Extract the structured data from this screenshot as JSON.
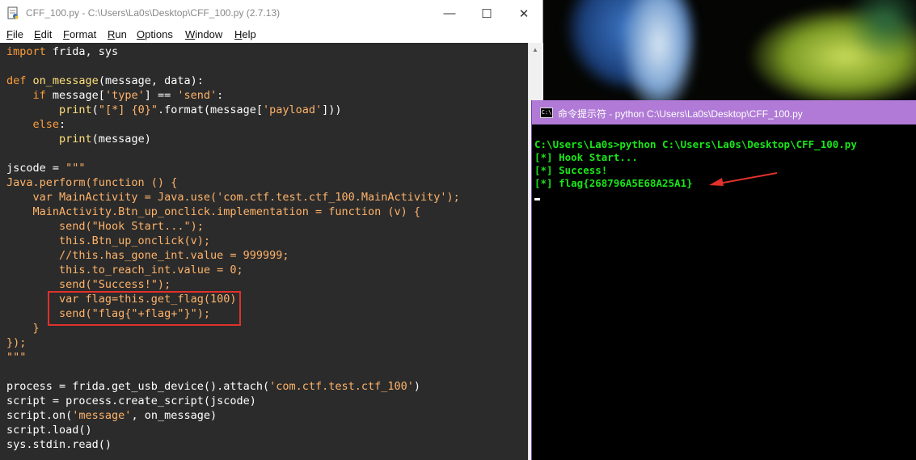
{
  "idle": {
    "title": "CFF_100.py - C:\\Users\\La0s\\Desktop\\CFF_100.py (2.7.13)",
    "controls": {
      "minimize": "—",
      "maximize": "☐",
      "close": "✕"
    },
    "menu": [
      {
        "key": "F",
        "rest": "ile"
      },
      {
        "key": "E",
        "rest": "dit"
      },
      {
        "key": "F",
        "rest": "ormat"
      },
      {
        "key": "R",
        "rest": "un"
      },
      {
        "key": "O",
        "rest": "ptions"
      },
      {
        "key": "W",
        "rest": "indow"
      },
      {
        "key": "H",
        "rest": "elp"
      }
    ],
    "code": [
      [
        [
          "kw",
          "import"
        ],
        [
          "t",
          " frida, sys"
        ]
      ],
      [],
      [
        [
          "kw",
          "def"
        ],
        [
          "t",
          " "
        ],
        [
          "fn",
          "on_message"
        ],
        [
          "t",
          "(message, data):"
        ]
      ],
      [
        [
          "t",
          "    "
        ],
        [
          "kw",
          "if"
        ],
        [
          "t",
          " message["
        ],
        [
          "str",
          "'type'"
        ],
        [
          "t",
          "] == "
        ],
        [
          "str",
          "'send'"
        ],
        [
          "t",
          ":"
        ]
      ],
      [
        [
          "t",
          "        "
        ],
        [
          "bi",
          "print"
        ],
        [
          "t",
          "("
        ],
        [
          "str",
          "\"[*] {0}\""
        ],
        [
          "t",
          ".format(message["
        ],
        [
          "str",
          "'payload'"
        ],
        [
          "t",
          "]))"
        ]
      ],
      [
        [
          "t",
          "    "
        ],
        [
          "kw",
          "else"
        ],
        [
          "t",
          ":"
        ]
      ],
      [
        [
          "t",
          "        "
        ],
        [
          "bi",
          "print"
        ],
        [
          "t",
          "(message)"
        ]
      ],
      [],
      [
        [
          "t",
          "jscode = "
        ],
        [
          "str",
          "\"\"\""
        ]
      ],
      [
        [
          "js",
          "Java.perform(function () {"
        ]
      ],
      [
        [
          "js",
          "    var MainActivity = Java.use('com.ctf.test.ctf_100.MainActivity');"
        ]
      ],
      [
        [
          "js",
          "    MainActivity.Btn_up_onclick.implementation = function (v) {"
        ]
      ],
      [
        [
          "js",
          "        send(\"Hook Start...\");"
        ]
      ],
      [
        [
          "js",
          "        this.Btn_up_onclick(v);"
        ]
      ],
      [
        [
          "js",
          "        //this.has_gone_int.value = 999999;"
        ]
      ],
      [
        [
          "js",
          "        this.to_reach_int.value = 0;"
        ]
      ],
      [
        [
          "js",
          "        send(\"Success!\");"
        ]
      ],
      [
        [
          "js",
          "        var flag=this.get_flag(100)"
        ]
      ],
      [
        [
          "js",
          "        send(\"flag{\"+flag+\"}\");"
        ]
      ],
      [
        [
          "js",
          "    }"
        ]
      ],
      [
        [
          "js",
          "});"
        ]
      ],
      [
        [
          "js",
          "\"\"\""
        ]
      ],
      [],
      [
        [
          "t",
          "process = frida.get_usb_device().attach("
        ],
        [
          "str",
          "'com.ctf.test.ctf_100'"
        ],
        [
          "t",
          ")"
        ]
      ],
      [
        [
          "t",
          "script = process.create_script(jscode)"
        ]
      ],
      [
        [
          "t",
          "script.on("
        ],
        [
          "str",
          "'message'"
        ],
        [
          "t",
          ", on_message)"
        ]
      ],
      [
        [
          "t",
          "script.load()"
        ]
      ],
      [
        [
          "t",
          "sys.stdin.read()"
        ]
      ]
    ]
  },
  "cmd": {
    "title": "命令提示符 - python  C:\\Users\\La0s\\Desktop\\CFF_100.py",
    "icon_label": "C:\\",
    "lines": [
      "C:\\Users\\La0s>python C:\\Users\\La0s\\Desktop\\CFF_100.py",
      "[*] Hook Start...",
      "[*] Success!",
      "[*] flag{268796A5E68A25A1}"
    ]
  },
  "annotations": {
    "box_color": "#e0312b",
    "arrow_color": "#e0312b"
  }
}
